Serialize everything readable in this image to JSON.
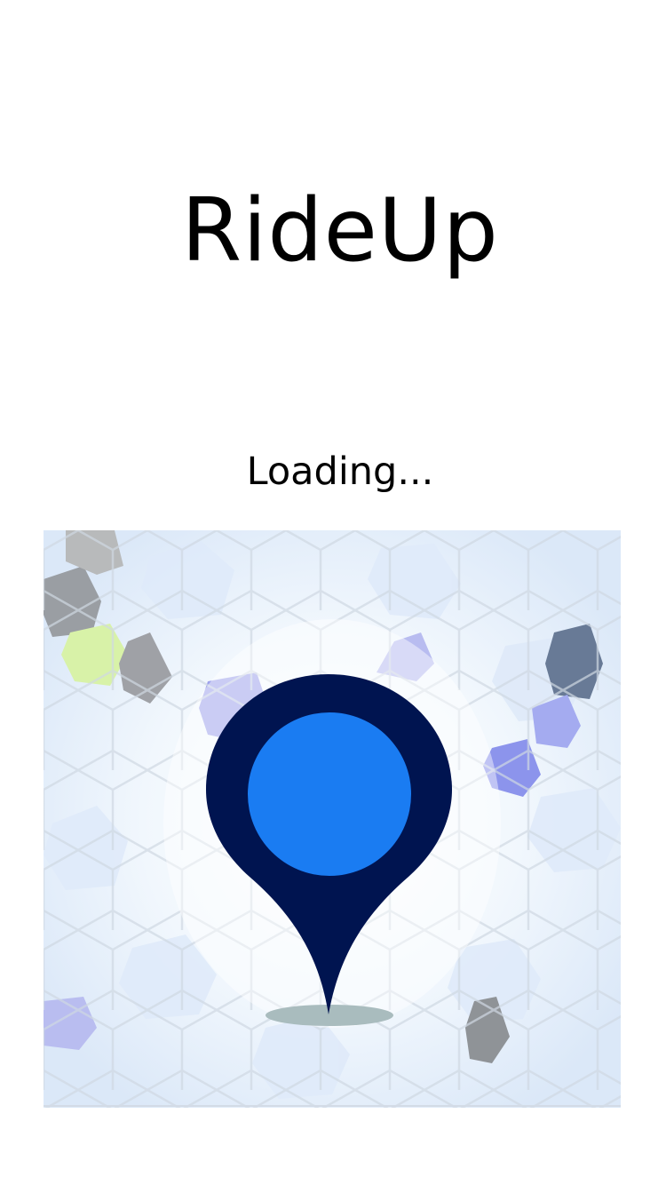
{
  "app": {
    "title": "RideUp"
  },
  "status": {
    "loading_text": "Loading..."
  },
  "splash": {
    "icon": "location-pin-icon",
    "background": "mosaic-tiles",
    "colors": {
      "pin_outer": "#001450",
      "pin_inner": "#1a7cf2",
      "shadow": "#a9bcbe",
      "tile_light": "#eaf3fb",
      "tile_gray": "#9a9ea3",
      "tile_green": "#d8f2a8",
      "tile_violet": "#8c94ec",
      "tile_slate": "#687a96"
    }
  }
}
